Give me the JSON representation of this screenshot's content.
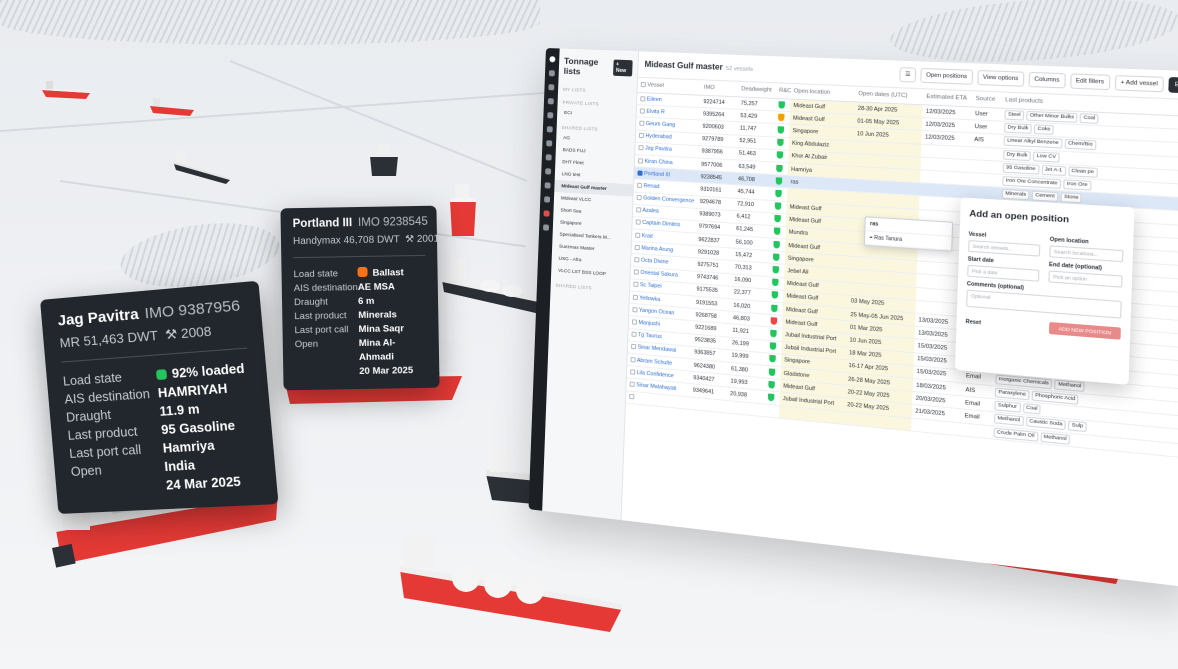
{
  "cards": {
    "jag": {
      "name": "Jag Pavitra",
      "imo": "IMO 9387956",
      "sub": "MR 51,463 DWT",
      "built": "2008",
      "rows": [
        {
          "k": "Load state",
          "v": "92% loaded",
          "dot": "#22c55e"
        },
        {
          "k": "AIS destination",
          "v": "HAMRIYAH"
        },
        {
          "k": "Draught",
          "v": "11.9 m"
        },
        {
          "k": "Last product",
          "v": "95 Gasoline"
        },
        {
          "k": "Last port call",
          "v": "Hamriya"
        },
        {
          "k": "Open",
          "v": "India\n24 Mar 2025"
        }
      ]
    },
    "portland": {
      "name": "Portland III",
      "imo": "IMO 9238545",
      "sub": "Handymax 46,708 DWT",
      "built": "2001",
      "rows": [
        {
          "k": "Load state",
          "v": "Ballast",
          "dot": "#f97316"
        },
        {
          "k": "AIS destination",
          "v": "AE MSA"
        },
        {
          "k": "Draught",
          "v": "6 m"
        },
        {
          "k": "Last product",
          "v": "Minerals"
        },
        {
          "k": "Last port call",
          "v": "Mina Saqr"
        },
        {
          "k": "Open",
          "v": "Mina Al-Ahmadi\n20 Mar 2025"
        }
      ]
    }
  },
  "app": {
    "title": "Tonnage lists",
    "new_label": "+ New",
    "groups": {
      "my": "MY LISTS",
      "private": "PRIVATE LISTS",
      "shared": "SHARED LISTS",
      "shared2": "SHARED LISTS"
    },
    "private_items": [
      "ECI"
    ],
    "shared_items": [
      "AG",
      "BADS FUJ",
      "DHT Fleet",
      "LNG test",
      "Mideast Gulf master",
      "Mideast VLCC",
      "Short Sea",
      "Singapore",
      "Specialised Tankers M...",
      "Suezmax Master",
      "USG - Afra",
      "VLCC LST BSS LOOP"
    ],
    "list_title": "Mideast Gulf master",
    "vessel_count": "52 vessels",
    "buttons": {
      "open_positions": "Open positions",
      "view_options": "View options",
      "columns": "Columns",
      "edit_filters": "Edit filters",
      "add_vessel": "+ Add vessel",
      "export": "Export"
    },
    "columns": [
      "Vessel",
      "IMO",
      "Deadweight",
      "R&C",
      "Open location",
      "Open dates (UTC)",
      "Estimated ETA",
      "Source",
      "Last products"
    ],
    "rows": [
      {
        "vessel": "Eileen",
        "imo": "9224714",
        "dwt": "75,257",
        "rc": "#22c55e",
        "loc": "Mideast Gulf",
        "dates": "28-30 Apr 2025",
        "eta": "12/03/2025",
        "src": "User",
        "prods": [
          "Steel",
          "Other Minor Bulks",
          "Coal"
        ]
      },
      {
        "vessel": "Elvita R",
        "imo": "9395264",
        "dwt": "53,429",
        "rc": "#f59e0b",
        "loc": "Mideast Gulf",
        "dates": "01-05 May 2025",
        "eta": "12/03/2025",
        "src": "User",
        "prods": [
          "Dry Bulk",
          "Coke"
        ]
      },
      {
        "vessel": "Geum Gang",
        "imo": "9200603",
        "dwt": "11,747",
        "rc": "#22c55e",
        "loc": "Singapore",
        "dates": "10 Jun 2025",
        "eta": "12/03/2025",
        "src": "AIS",
        "prods": [
          "Linear Alkyl Benzene",
          "Chem/Bio"
        ]
      },
      {
        "vessel": "Hyderabad",
        "imo": "9279789",
        "dwt": "52,951",
        "rc": "#22c55e",
        "loc": "King Abdulaziz",
        "dates": "",
        "eta": "",
        "src": "",
        "prods": [
          "Dry Bulk",
          "Low CV"
        ]
      },
      {
        "vessel": "Jag Pavitra",
        "imo": "9387956",
        "dwt": "51,463",
        "rc": "#22c55e",
        "loc": "Khor Al Zubair",
        "dates": "",
        "eta": "",
        "src": "",
        "prods": [
          "95 Gasoline",
          "Jet A-1",
          "Clean pe"
        ]
      },
      {
        "vessel": "Kiran China",
        "imo": "9577006",
        "dwt": "63,549",
        "rc": "#22c55e",
        "loc": "Hamriya",
        "dates": "",
        "eta": "",
        "src": "",
        "prods": [
          "Iron Ore Concentrate",
          "Iron Ore"
        ]
      },
      {
        "vessel": "Portland III",
        "imo": "9238545",
        "dwt": "46,708",
        "rc": "#22c55e",
        "loc": "ras",
        "dates": "",
        "eta": "",
        "src": "",
        "prods": [
          "Minerals",
          "Cement",
          "Stone"
        ],
        "sel": true
      },
      {
        "vessel": "Renad",
        "imo": "9310161",
        "dwt": "45,744",
        "rc": "#22c55e",
        "loc": "",
        "dates": "",
        "eta": "",
        "src": "",
        "prods": [
          "High Sulphur Straight Run Fuel Oil"
        ]
      },
      {
        "vessel": "Golden Convergence",
        "imo": "9294678",
        "dwt": "72,910",
        "rc": "#22c55e",
        "loc": "Mideast Gulf",
        "dates": "",
        "eta": "",
        "src": "",
        "prods": [
          "Naphtha"
        ]
      },
      {
        "vessel": "Azalea",
        "imo": "9389073",
        "dwt": "6,412",
        "rc": "#22c55e",
        "loc": "Mideast Gulf",
        "dates": "",
        "eta": "",
        "src": "",
        "prods": []
      },
      {
        "vessel": "Captain Dimitris",
        "imo": "9797694",
        "dwt": "61,245",
        "rc": "#22c55e",
        "loc": "Mundra",
        "dates": "",
        "eta": "",
        "src": "",
        "prods": []
      },
      {
        "vessel": "Krait",
        "imo": "9622837",
        "dwt": "56,100",
        "rc": "#22c55e",
        "loc": "Mideast Gulf",
        "dates": "",
        "eta": "",
        "src": "",
        "prods": [
          "Sulphur",
          "Dry Bulk",
          "Manganese"
        ]
      },
      {
        "vessel": "Marina Arung",
        "imo": "9291028",
        "dwt": "15,472",
        "rc": "#22c55e",
        "loc": "Singapore",
        "dates": "",
        "eta": "",
        "src": "",
        "prods": [
          "Cement",
          "Minor Bulks",
          "White"
        ]
      },
      {
        "vessel": "Octa Divine",
        "imo": "9275751",
        "dwt": "70,313",
        "rc": "#22c55e",
        "loc": "Jebel Ali",
        "dates": "",
        "eta": "",
        "src": "",
        "prods": [
          "Paraxylene",
          "Base Oil"
        ]
      },
      {
        "vessel": "Oriental Sakura",
        "imo": "9743746",
        "dwt": "16,090",
        "rc": "#22c55e",
        "loc": "Mideast Gulf",
        "dates": "",
        "eta": "",
        "src": "",
        "prods": [
          "Very Low Sulphur Fuel Oil",
          "Crac"
        ]
      },
      {
        "vessel": "Sc Taipei",
        "imo": "9175535",
        "dwt": "22,377",
        "rc": "#22c55e",
        "loc": "Mideast Gulf",
        "dates": "03 May 2025",
        "eta": "",
        "src": "",
        "prods": [
          "Chemicals",
          "Other Chemicals"
        ]
      },
      {
        "vessel": "Yellowka",
        "imo": "9191553",
        "dwt": "16,020",
        "rc": "#22c55e",
        "loc": "Mideast Gulf",
        "dates": "25 May-05 Jun 2025",
        "eta": "13/03/2025",
        "src": "AIS",
        "prods": [
          "Methanol",
          "Vinyl Acetate Monomer"
        ]
      },
      {
        "vessel": "Yangon Ocean",
        "imo": "9268758",
        "dwt": "46,803",
        "rc": "#ef4444",
        "loc": "Mideast Gulf",
        "dates": "01 Mar 2025",
        "eta": "13/03/2025",
        "src": "Email",
        "prods": [
          "Molasses",
          "Chem/Bio",
          "Sunflo"
        ]
      },
      {
        "vessel": "Manjushi",
        "imo": "9221689",
        "dwt": "11,921",
        "rc": "#22c55e",
        "loc": "Jubail Industrial Port",
        "dates": "10 Jun 2025",
        "eta": "15/03/2025",
        "src": "User",
        "prods": [
          "Caustic Soda",
          "Chem/Bio",
          "Mo"
        ]
      },
      {
        "vessel": "Tg Taurus",
        "imo": "9523835",
        "dwt": "26,199",
        "rc": "#22c55e",
        "loc": "Jubail Industrial Port",
        "dates": "18 Mar 2025",
        "eta": "15/03/2025",
        "src": "Email",
        "prods": [
          "Vinyl Acetate Monomer",
          "Chemi"
        ]
      },
      {
        "vessel": "Sinar Mendawai",
        "imo": "9363857",
        "dwt": "19,999",
        "rc": "#22c55e",
        "loc": "Singapore",
        "dates": "16-17 Apr 2025",
        "eta": "15/03/2025",
        "src": "Email",
        "prods": [
          "Inorganic Chemicals",
          "Methanol"
        ]
      },
      {
        "vessel": "Abram Schulte",
        "imo": "9624380",
        "dwt": "61,380",
        "rc": "#22c55e",
        "loc": "Gladstone",
        "dates": "26-28 May 2025",
        "eta": "18/03/2025",
        "src": "AIS",
        "prods": [
          "Paraxylene",
          "Phosphoric Acid"
        ]
      },
      {
        "vessel": "Lila Confidence",
        "imo": "9340427",
        "dwt": "19,993",
        "rc": "#22c55e",
        "loc": "Mideast Gulf",
        "dates": "20-22 May 2025",
        "eta": "20/03/2025",
        "src": "Email",
        "prods": [
          "Sulphur",
          "Coal"
        ]
      },
      {
        "vessel": "Sinar Malahayati",
        "imo": "9349641",
        "dwt": "20,938",
        "rc": "#22c55e",
        "loc": "Jubail Industrial Port",
        "dates": "20-22 May 2025",
        "eta": "21/03/2025",
        "src": "Email",
        "prods": [
          "Methanol",
          "Caustic Soda",
          "Sulp"
        ]
      },
      {
        "vessel": "",
        "imo": "",
        "dwt": "",
        "rc": "",
        "loc": "",
        "dates": "",
        "eta": "",
        "src": "",
        "prods": [
          "Crude Palm Oil",
          "Methanol"
        ]
      }
    ],
    "dropdown": {
      "query": "ras",
      "option": "Ras Tanura"
    },
    "popup": {
      "title": "Add an open position",
      "vessel_label": "Vessel",
      "vessel_ph": "Search vessels...",
      "location_label": "Open location",
      "location_ph": "Search locations...",
      "start_label": "Start date",
      "start_ph": "Pick a date",
      "end_label": "End date (optional)",
      "end_ph": "Pick an option",
      "comments_label": "Comments (optional)",
      "comments_ph": "Optional",
      "reset": "Reset",
      "add": "ADD NEW POSITION"
    }
  }
}
